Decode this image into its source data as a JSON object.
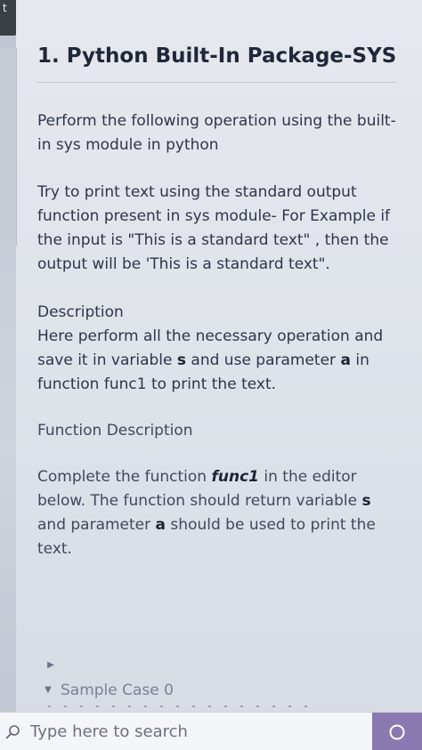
{
  "window": {
    "corner_text": "t"
  },
  "question": {
    "title": "1. Python Built-In Package-SYS",
    "paragraph1": "Perform the following operation using the built-in sys module in python",
    "paragraph2": "Try to print text using the standard output function present in sys module- For Example if the input is \"This is a standard text\" , then the output will be 'This is a standard text\".",
    "description": {
      "heading": "Description",
      "text_before_s": "Here perform all the necessary operation and save it in variable ",
      "var_s": "s",
      "text_between": " and use parameter ",
      "param_a": "a",
      "text_after": " in function func1 to print the text."
    },
    "function_description": {
      "heading": "Function Description"
    },
    "complete": {
      "text_before": "Complete the function ",
      "func_name": "func1",
      "text_middle": " in the editor below. The function should return variable ",
      "var_s": "s",
      "text_middle2": " and parameter ",
      "param_a": "a",
      "text_after": " should be used to print the text."
    },
    "sample": {
      "label": "Sample Case 0"
    }
  },
  "taskbar": {
    "search_placeholder": "Type here to search",
    "accent_color": "#8a79b0"
  },
  "icons": {
    "search": "search-icon",
    "expand": "play-icon",
    "collapse": "caret-down-icon",
    "taskbar_button": "circle-icon"
  }
}
